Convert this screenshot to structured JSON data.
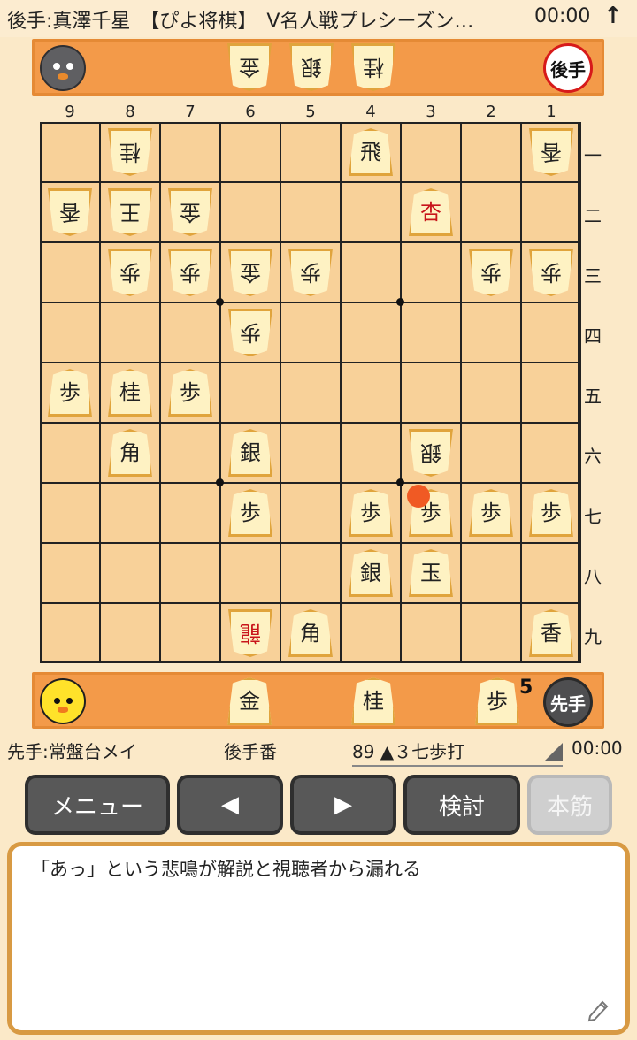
{
  "header": {
    "title": "後手:真澤千星　【ぴよ将棋】　V名人戦プレシーズン…",
    "time": "00:00",
    "arrow_icon": "up-arrow-icon"
  },
  "gote_hand": {
    "badge": "後手",
    "pieces": [
      "金",
      "銀",
      "桂"
    ]
  },
  "sente_hand": {
    "badge": "先手",
    "pieces": [
      {
        "label": "金"
      },
      {
        "label": "桂"
      },
      {
        "label": "歩",
        "count": "5"
      }
    ]
  },
  "board": {
    "file_labels": [
      "9",
      "8",
      "7",
      "6",
      "5",
      "4",
      "3",
      "2",
      "1"
    ],
    "rank_labels": [
      "一",
      "二",
      "三",
      "四",
      "五",
      "六",
      "七",
      "八",
      "九"
    ],
    "pieces": [
      {
        "label": "桂",
        "file": 8,
        "rank": 1,
        "owner": "gote",
        "promoted": false
      },
      {
        "label": "飛",
        "file": 4,
        "rank": 1,
        "owner": "sente",
        "promoted": false
      },
      {
        "label": "香",
        "file": 1,
        "rank": 1,
        "owner": "gote",
        "promoted": false
      },
      {
        "label": "香",
        "file": 9,
        "rank": 2,
        "owner": "gote",
        "promoted": false
      },
      {
        "label": "王",
        "file": 8,
        "rank": 2,
        "owner": "gote",
        "promoted": false
      },
      {
        "label": "金",
        "file": 7,
        "rank": 2,
        "owner": "gote",
        "promoted": false
      },
      {
        "label": "杏",
        "file": 3,
        "rank": 2,
        "owner": "sente",
        "promoted": true
      },
      {
        "label": "歩",
        "file": 8,
        "rank": 3,
        "owner": "gote",
        "promoted": false
      },
      {
        "label": "歩",
        "file": 7,
        "rank": 3,
        "owner": "gote",
        "promoted": false
      },
      {
        "label": "金",
        "file": 6,
        "rank": 3,
        "owner": "gote",
        "promoted": false
      },
      {
        "label": "歩",
        "file": 5,
        "rank": 3,
        "owner": "gote",
        "promoted": false
      },
      {
        "label": "歩",
        "file": 2,
        "rank": 3,
        "owner": "gote",
        "promoted": false
      },
      {
        "label": "歩",
        "file": 1,
        "rank": 3,
        "owner": "gote",
        "promoted": false
      },
      {
        "label": "歩",
        "file": 6,
        "rank": 4,
        "owner": "gote",
        "promoted": false
      },
      {
        "label": "歩",
        "file": 9,
        "rank": 5,
        "owner": "sente",
        "promoted": false
      },
      {
        "label": "桂",
        "file": 8,
        "rank": 5,
        "owner": "sente",
        "promoted": false
      },
      {
        "label": "歩",
        "file": 7,
        "rank": 5,
        "owner": "sente",
        "promoted": false
      },
      {
        "label": "角",
        "file": 8,
        "rank": 6,
        "owner": "sente",
        "promoted": false
      },
      {
        "label": "銀",
        "file": 6,
        "rank": 6,
        "owner": "sente",
        "promoted": false
      },
      {
        "label": "銀",
        "file": 3,
        "rank": 6,
        "owner": "gote",
        "promoted": false
      },
      {
        "label": "歩",
        "file": 6,
        "rank": 7,
        "owner": "sente",
        "promoted": false
      },
      {
        "label": "歩",
        "file": 4,
        "rank": 7,
        "owner": "sente",
        "promoted": false
      },
      {
        "label": "歩",
        "file": 3,
        "rank": 7,
        "owner": "sente",
        "promoted": false
      },
      {
        "label": "歩",
        "file": 2,
        "rank": 7,
        "owner": "sente",
        "promoted": false
      },
      {
        "label": "歩",
        "file": 1,
        "rank": 7,
        "owner": "sente",
        "promoted": false
      },
      {
        "label": "銀",
        "file": 4,
        "rank": 8,
        "owner": "sente",
        "promoted": false
      },
      {
        "label": "玉",
        "file": 3,
        "rank": 8,
        "owner": "sente",
        "promoted": false
      },
      {
        "label": "龍",
        "file": 6,
        "rank": 9,
        "owner": "gote",
        "promoted": true
      },
      {
        "label": "角",
        "file": 5,
        "rank": 9,
        "owner": "sente",
        "promoted": false
      },
      {
        "label": "香",
        "file": 1,
        "rank": 9,
        "owner": "sente",
        "promoted": false
      }
    ],
    "last_move": {
      "file": 3,
      "rank": 7
    },
    "colors": {
      "board": "#f8d199",
      "marker": "#f05a24",
      "promoted": "#c8141b",
      "hand": "#f39a49"
    }
  },
  "status": {
    "sente_player": "先手:常盤台メイ",
    "turn": "後手番",
    "move": "89 ▲３七歩打",
    "time": "00:00"
  },
  "buttons": {
    "menu": "メニュー",
    "prev_icon": "◀",
    "next_icon": "▶",
    "review": "検討",
    "main_line": "本筋"
  },
  "comment": {
    "text": "「あっ」という悲鳴が解説と視聴者から漏れる",
    "edit_icon": "pencil-icon"
  }
}
